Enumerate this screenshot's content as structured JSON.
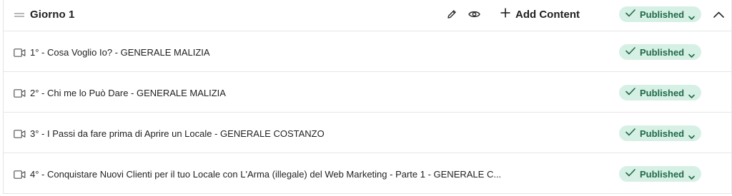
{
  "section": {
    "title": "Giorno 1",
    "add_content_label": "Add Content",
    "status_label": "Published"
  },
  "lessons": [
    {
      "title": "1° - Cosa Voglio Io? - GENERALE MALIZIA",
      "status": "Published",
      "icon": "video-icon"
    },
    {
      "title": "2° - Chi me lo Può Dare - GENERALE MALIZIA",
      "status": "Published",
      "icon": "video-icon"
    },
    {
      "title": "3° - I Passi da fare prima di Aprire un Locale - GENERALE COSTANZO",
      "status": "Published",
      "icon": "video-icon"
    },
    {
      "title": "4° - Conquistare Nuovi Clienti per il tuo Locale con L'Arma (illegale) del Web Marketing - Parte 1 - GENERALE C...",
      "status": "Published",
      "icon": "video-icon"
    }
  ],
  "colors": {
    "badge_bg": "#d7f0e6",
    "badge_text": "#1f6a47",
    "border": "#e6e6e6",
    "text": "#1f1f1f"
  },
  "icons": [
    "drag-handle-icon",
    "pencil-icon",
    "eye-icon",
    "plus-icon",
    "check-icon",
    "chevron-down-icon",
    "chevron-up-icon",
    "video-icon"
  ]
}
